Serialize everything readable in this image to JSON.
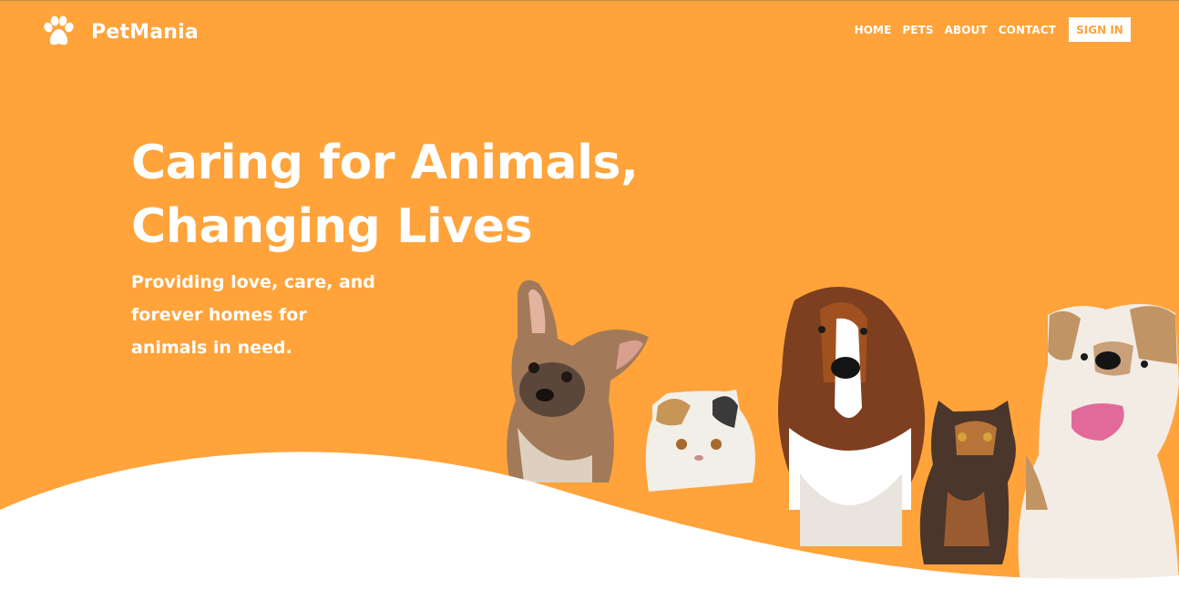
{
  "brand": {
    "name": "PetMania",
    "icon": "paw-icon"
  },
  "nav": {
    "items": [
      {
        "label": "HOME"
      },
      {
        "label": "PETS"
      },
      {
        "label": "ABOUT"
      },
      {
        "label": "CONTACT"
      }
    ],
    "signin_label": "SIGN IN"
  },
  "hero": {
    "headline_line1": "Caring for Animals,",
    "headline_line2": "Changing Lives",
    "subtext_line1": "Providing love, care, and",
    "subtext_line2": "forever homes for",
    "subtext_line3": "animals in need.",
    "image": "group-of-dogs-and-cats"
  },
  "colors": {
    "accent": "#FFA33A",
    "text_on_accent": "#FFFFFF",
    "background": "#FFFFFF"
  }
}
